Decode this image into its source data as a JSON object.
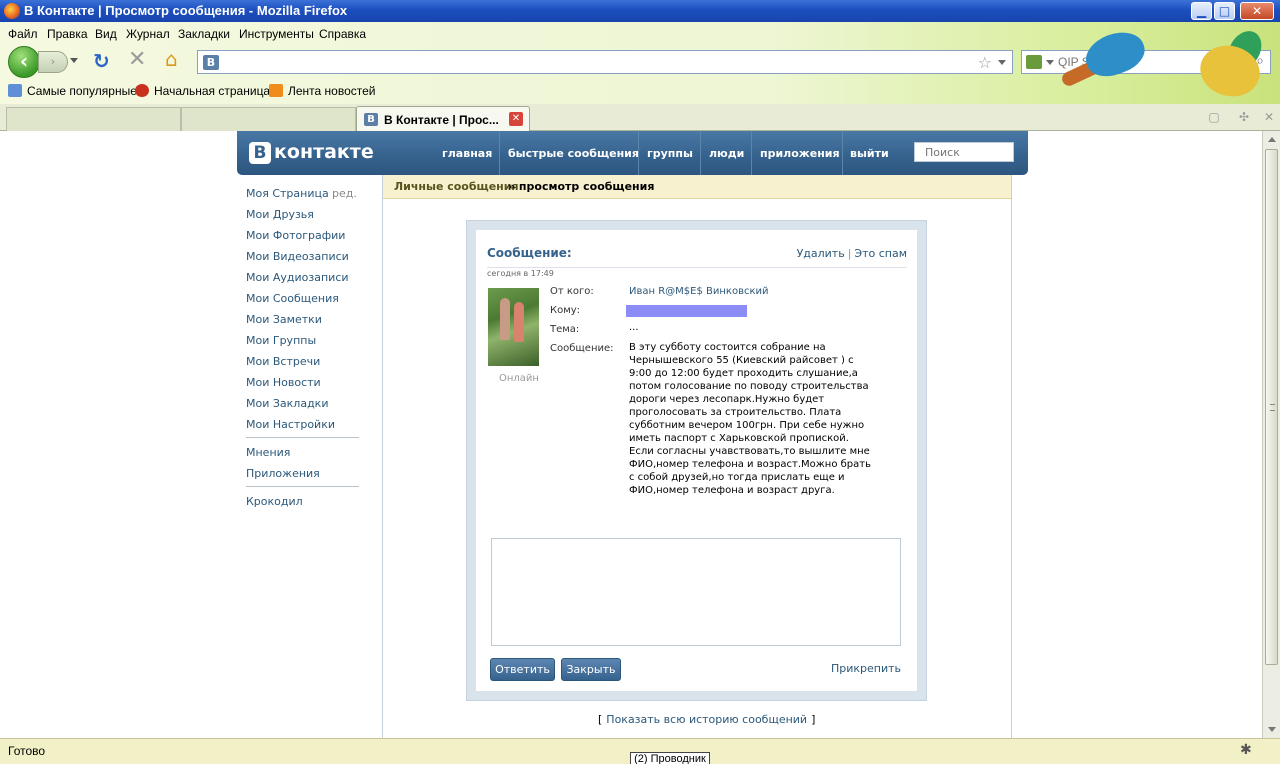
{
  "window": {
    "title": "В Контакте | Просмотр сообщения - Mozilla Firefox",
    "min_label": "▁",
    "max_label": "□",
    "close_label": "✕"
  },
  "menu": {
    "items": [
      "Файл",
      "Правка",
      "Вид",
      "Журнал",
      "Закладки",
      "Инструменты",
      "Справка"
    ]
  },
  "nav": {
    "url": "",
    "search_placeholder": "QIP Search"
  },
  "bookmarks": {
    "items": [
      "Самые популярные",
      "Начальная страница",
      "Лента новостей"
    ]
  },
  "tabs": {
    "active_label": "В Контакте | Прос...",
    "site_letter": "B"
  },
  "vk": {
    "logo_letter": "B",
    "logo_text": "контакте",
    "nav": [
      "главная",
      "быстрые сообщения",
      "группы",
      "люди",
      "приложения",
      "выйти"
    ],
    "search_placeholder": "Поиск",
    "sidebar": {
      "items": [
        "Моя Страница",
        "Мои Друзья",
        "Мои Фотографии",
        "Мои Видеозаписи",
        "Мои Аудиозаписи",
        "Мои Сообщения",
        "Мои Заметки",
        "Мои Группы",
        "Мои Встречи",
        "Мои Новости",
        "Мои Закладки",
        "Мои Настройки"
      ],
      "edit_label": "ред.",
      "extra": [
        "Мнения",
        "Приложения"
      ],
      "bottom": [
        "Крокодил"
      ]
    },
    "breadcrumb": {
      "link": "Личные сообщения",
      "current": "» просмотр сообщения"
    },
    "message": {
      "title": "Сообщение:",
      "delete_label": "Удалить",
      "spam_label": "Это спам",
      "date": "сегодня в 17:49",
      "online_label": "Онлайн",
      "from_label": "От кого:",
      "from_value": "Иван R@M$E$ Винковский",
      "to_label": "Кому:",
      "subject_label": "Тема:",
      "subject_value": "...",
      "body_label": "Сообщение:",
      "body": "В эту субботу состоится собрание на Чернышевского 55 (Киевский райсовет ) с 9:00 до 12:00 будет проходить слушание,а потом голосование по поводу строительства дороги через лесопарк.Нужно будет проголосовать за строительство. Плата субботним вечером 100грн. При себе нужно иметь паспорт с Харьковской пропиской. Если согласны учавствовать,то вышлите мне ФИО,номер телефона и возраст.Можно брать с собой друзей,но тогда прислать еще и ФИО,номер телефона и возраст друга.",
      "reply_button": "Ответить",
      "close_button": "Закрыть",
      "attach_label": "Прикрепить"
    },
    "history": {
      "open": "[",
      "link": "Показать всю историю сообщений",
      "close": "]"
    }
  },
  "status": {
    "text": "Готово",
    "taskbar": "(2) Проводник"
  },
  "colors": {
    "vk_blue": "#36638e",
    "vk_link": "#2b587a",
    "redaction": "#8c8cf6"
  }
}
